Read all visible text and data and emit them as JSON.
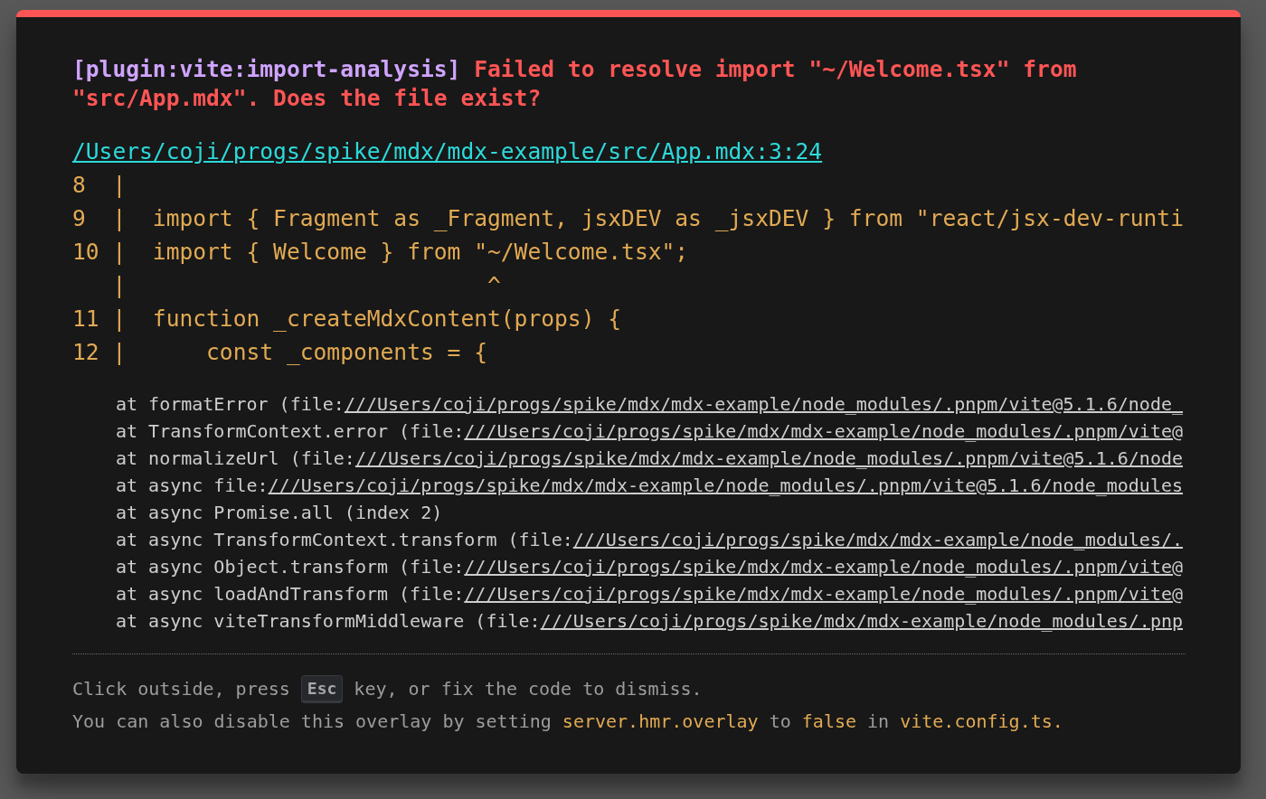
{
  "overlay": {
    "plugin": "[plugin:vite:import-analysis]",
    "message": "Failed to resolve import \"~/Welcome.tsx\" from \"src/App.mdx\". Does the file exist?",
    "file": "/Users/coji/progs/spike/mdx/mdx-example/src/App.mdx:3:24",
    "code_frame": [
      "8  |",
      "9  |  import { Fragment as _Fragment, jsxDEV as _jsxDEV } from \"react/jsx-dev-runti",
      "10 |  import { Welcome } from \"~/Welcome.tsx\";",
      "   |                           ^",
      "11 |  function _createMdxContent(props) {",
      "12 |      const _components = {"
    ],
    "stack": [
      {
        "text": "at formatError (file:",
        "link": "///Users/coji/progs/spike/mdx/mdx-example/node_modules/.pnpm/vite@5.1.6/node_"
      },
      {
        "text": "at TransformContext.error (file:",
        "link": "///Users/coji/progs/spike/mdx/mdx-example/node_modules/.pnpm/vite@"
      },
      {
        "text": "at normalizeUrl (file:",
        "link": "///Users/coji/progs/spike/mdx/mdx-example/node_modules/.pnpm/vite@5.1.6/node"
      },
      {
        "text": "at async file:",
        "link": "///Users/coji/progs/spike/mdx/mdx-example/node_modules/.pnpm/vite@5.1.6/node_modules"
      },
      {
        "text": "at async Promise.all (index 2)"
      },
      {
        "text": "at async TransformContext.transform (file:",
        "link": "///Users/coji/progs/spike/mdx/mdx-example/node_modules/."
      },
      {
        "text": "at async Object.transform (file:",
        "link": "///Users/coji/progs/spike/mdx/mdx-example/node_modules/.pnpm/vite@"
      },
      {
        "text": "at async loadAndTransform (file:",
        "link": "///Users/coji/progs/spike/mdx/mdx-example/node_modules/.pnpm/vite@"
      },
      {
        "text": "at async viteTransformMiddleware (file:",
        "link": "///Users/coji/progs/spike/mdx/mdx-example/node_modules/.pnp"
      }
    ],
    "tip": {
      "before": "Click outside, press",
      "key": "Esc",
      "after": "key, or fix the code to dismiss."
    },
    "note": [
      {
        "kind": "text",
        "text": "You can also disable this overlay by setting"
      },
      {
        "kind": "code",
        "text": "server.hmr.overlay"
      },
      {
        "kind": "text",
        "text": "to"
      },
      {
        "kind": "code",
        "text": "false"
      },
      {
        "kind": "text",
        "text": "in"
      },
      {
        "kind": "code",
        "text": "vite.config.ts."
      }
    ]
  }
}
